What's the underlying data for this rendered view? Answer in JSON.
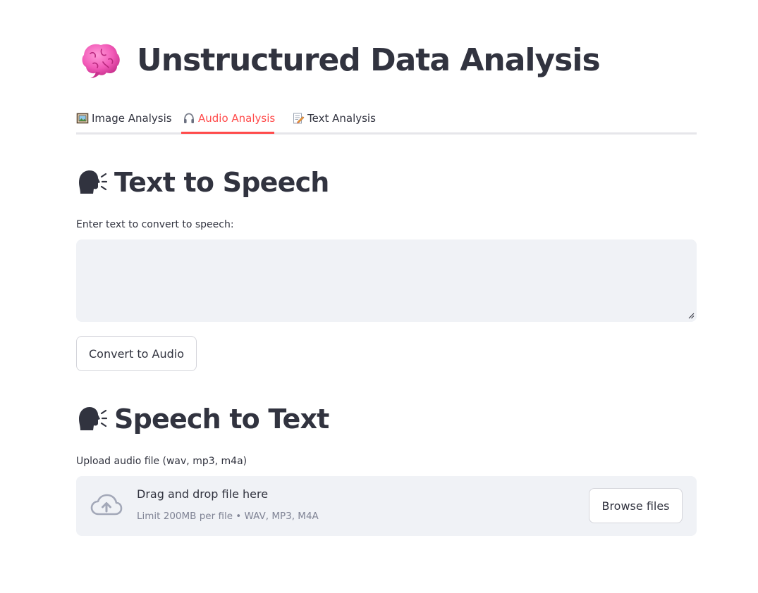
{
  "app": {
    "title": "Unstructured Data Analysis",
    "title_icon": "brain-icon"
  },
  "tabs": [
    {
      "label": "Image Analysis",
      "icon": "framed-picture-icon",
      "active": false
    },
    {
      "label": "Audio Analysis",
      "icon": "headphones-icon",
      "active": true
    },
    {
      "label": "Text Analysis",
      "icon": "memo-icon",
      "active": false
    }
  ],
  "tts": {
    "heading": "Text to Speech",
    "heading_icon": "speaking-head-icon",
    "input_label": "Enter text to convert to speech:",
    "input_value": "",
    "convert_button": "Convert to Audio"
  },
  "stt": {
    "heading": "Speech to Text",
    "heading_icon": "speaking-head-icon",
    "upload_label": "Upload audio file (wav, mp3, m4a)",
    "drop_text": "Drag and drop file here",
    "limit_text": "Limit 200MB per file • WAV, MP3, M4A",
    "browse_button": "Browse files",
    "upload_icon": "cloud-upload-icon"
  },
  "colors": {
    "accent": "#ff4b4b",
    "text": "#31333f",
    "muted": "#808495",
    "input_bg": "#f0f2f6",
    "tab_border": "#e6e6ea"
  }
}
